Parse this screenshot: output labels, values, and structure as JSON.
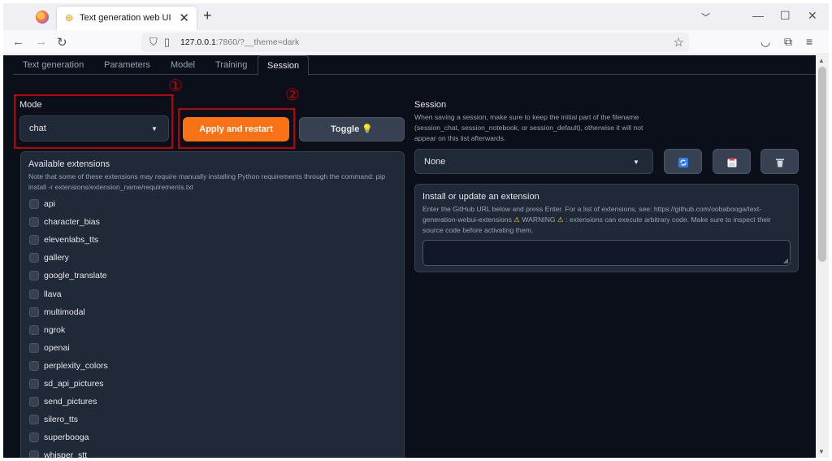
{
  "browser": {
    "tab_title": "Text generation web UI",
    "tab_close": "✕",
    "new_tab": "+",
    "url_host": "127.0.0.1",
    "url_rest": ":7860/?__theme=dark"
  },
  "tabs": [
    {
      "label": "Text generation"
    },
    {
      "label": "Parameters"
    },
    {
      "label": "Model"
    },
    {
      "label": "Training"
    },
    {
      "label": "Session"
    }
  ],
  "annotations": {
    "step1": "①",
    "step2": "②"
  },
  "mode": {
    "label": "Mode",
    "value": "chat"
  },
  "buttons": {
    "apply": "Apply and restart",
    "toggle": "Toggle",
    "toggle_emoji": "💡"
  },
  "extensions": {
    "title": "Available extensions",
    "note": "Note that some of these extensions may require manually installing Python requirements through the command: pip install -r extensions/extension_name/requirements.txt",
    "items": [
      "api",
      "character_bias",
      "elevenlabs_tts",
      "gallery",
      "google_translate",
      "llava",
      "multimodal",
      "ngrok",
      "openai",
      "perplexity_colors",
      "sd_api_pictures",
      "send_pictures",
      "silero_tts",
      "superbooga",
      "whisper_stt"
    ]
  },
  "session": {
    "label": "Session",
    "note": "When saving a session, make sure to keep the initial part of the filename (session_chat, session_notebook, or session_default), otherwise it will not appear on this list afterwards.",
    "value": "None"
  },
  "install": {
    "title": "Install or update an extension",
    "note_before": "Enter the GitHub URL below and press Enter. For a list of extensions, see: https://github.com/oobabooga/text-generation-webui-extensions ",
    "warn_word": "WARNING",
    "note_after": ": extensions can execute arbitrary code. Make sure to inspect their source code before activating them."
  },
  "colors": {
    "accent": "#f97316",
    "background": "#0b0f19",
    "panel": "#1f2937",
    "annotation": "#c00000"
  },
  "icons": [
    "firefox-logo-icon",
    "refresh-icon",
    "save-icon",
    "delete-icon",
    "lightbulb-icon",
    "warning-icon"
  ]
}
